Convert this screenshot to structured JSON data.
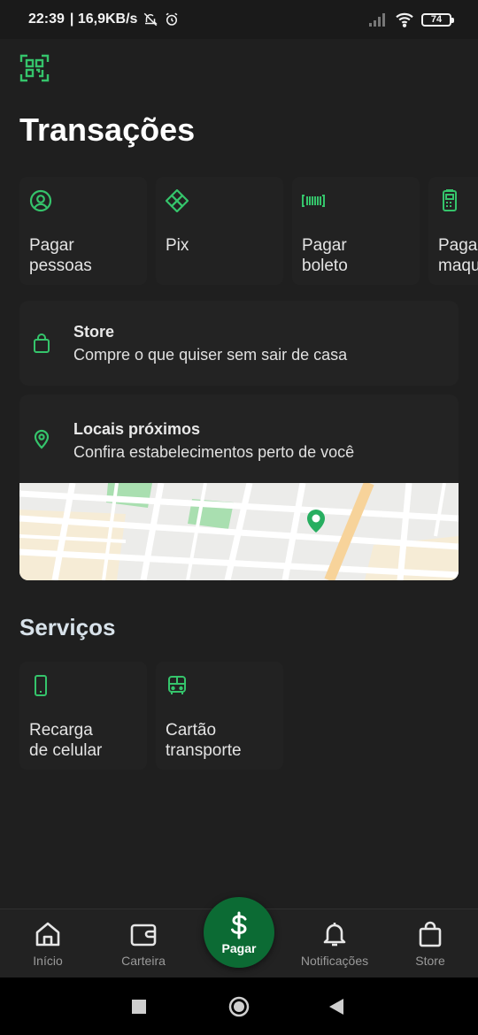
{
  "status_bar": {
    "time": "22:39",
    "net_speed": "| 16,9KB/s",
    "battery": "74"
  },
  "page_title": "Transações",
  "actions": [
    {
      "label": "Pagar\npessoas",
      "icon": "person-circle-icon"
    },
    {
      "label": "Pix",
      "icon": "pix-icon"
    },
    {
      "label": "Pagar\nboleto",
      "icon": "barcode-icon"
    },
    {
      "label": "Paga\nmaqu",
      "icon": "card-machine-icon"
    }
  ],
  "store_card": {
    "title": "Store",
    "subtitle": "Compre o que quiser sem sair de casa",
    "icon": "shopping-bag-icon"
  },
  "nearby_card": {
    "title": "Locais próximos",
    "subtitle": "Confira estabelecimentos perto de você",
    "icon": "location-pin-icon"
  },
  "services_title": "Serviços",
  "services": [
    {
      "label": "Recarga\nde celular",
      "icon": "phone-icon"
    },
    {
      "label": "Cartão\ntransporte",
      "icon": "bus-icon"
    }
  ],
  "bottom_nav": {
    "items": [
      {
        "label": "Início",
        "icon": "home-icon"
      },
      {
        "label": "Carteira",
        "icon": "wallet-icon"
      },
      {
        "label": "Notificações",
        "icon": "bell-icon"
      },
      {
        "label": "Store",
        "icon": "shopping-bag-icon"
      }
    ],
    "pay_label": "Pagar"
  },
  "colors": {
    "accent": "#35c46b",
    "background": "#1f1f1f",
    "card": "#222222",
    "pay_button": "#0c6b34"
  }
}
